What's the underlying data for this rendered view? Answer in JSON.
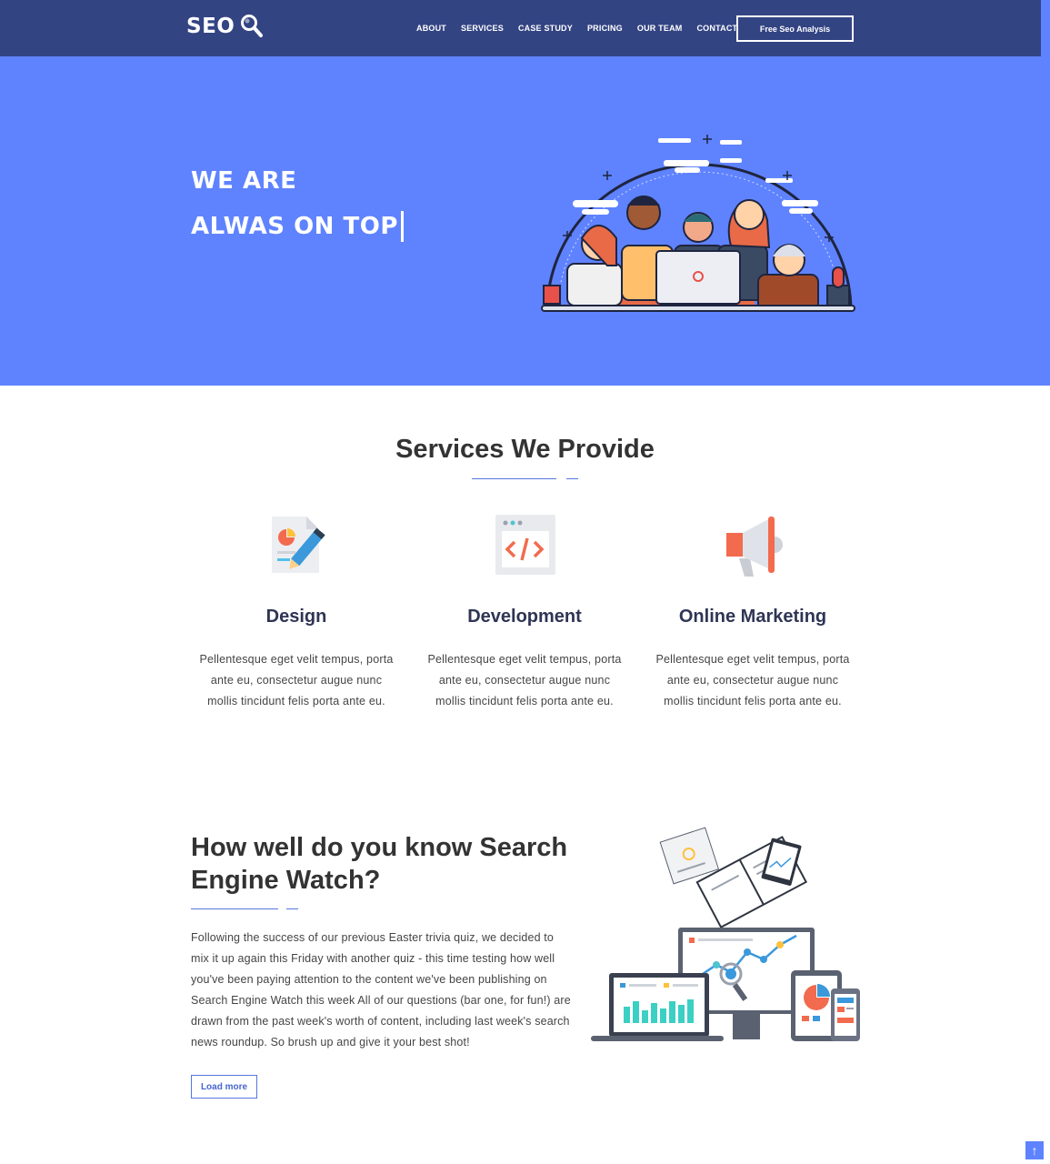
{
  "header": {
    "logo_text": "SEO",
    "nav": [
      "ABOUT",
      "SERVICES",
      "CASE STUDY",
      "PRICING",
      "OUR TEAM",
      "CONTACT"
    ],
    "cta_label": "Free Seo Analysis"
  },
  "hero": {
    "line1": "WE ARE",
    "line2": "ALWAS ON TOP"
  },
  "services": {
    "title": "Services We Provide",
    "items": [
      {
        "title": "Design",
        "text": "Pellentesque eget velit tempus, porta ante eu, consectetur augue nunc mollis tincidunt felis porta ante eu.",
        "icon": "design-document-pencil-icon"
      },
      {
        "title": "Development",
        "text": "Pellentesque eget velit tempus, porta ante eu, consectetur augue nunc mollis tincidunt felis porta ante eu.",
        "icon": "code-window-icon"
      },
      {
        "title": "Online Marketing",
        "text": "Pellentesque eget velit tempus, porta ante eu, consectetur augue nunc mollis tincidunt felis porta ante eu.",
        "icon": "megaphone-icon"
      }
    ]
  },
  "article": {
    "title": "How well do you know Search Engine Watch?",
    "text": "Following the success of our previous Easter trivia quiz, we decided to mix it up again this Friday with another quiz - this time testing how well you've been paying attention to the content we've been publishing on Search Engine Watch this week All of our questions (bar one, for fun!) are drawn from the past week's worth of content, including last week's search news roundup. So brush up and give it your best shot!",
    "button": "Load more"
  },
  "colors": {
    "nav_bg": "#334483",
    "hero_bg": "#5f83ff",
    "accent": "#5577dd"
  }
}
